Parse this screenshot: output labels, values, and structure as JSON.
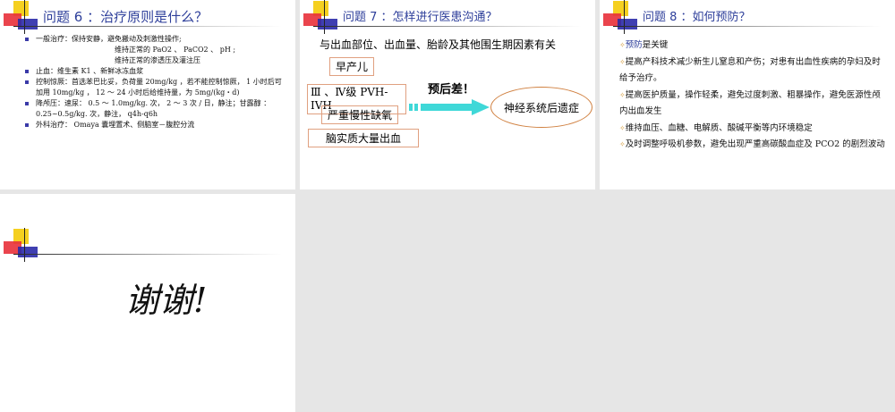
{
  "slide6": {
    "title": "问题 6 ：治疗原则是什么？",
    "items": [
      {
        "text": "一般治疗：保持安静，避免搬动及刺激性操作;",
        "sub": [
          "维持正常的 PaO2 、 PaCO2 、 pH ;",
          "维持正常的渗透压及灌注压"
        ]
      },
      {
        "text": "止血：维生素 K1 、新鲜冰冻血浆"
      },
      {
        "text": "控制惊厥：首选苯巴比妥，负荷量 20mg/kg ，若不能控制惊厥， 1 小时后可加用 10mg/kg ， 12 ～ 24 小时后给维持量，为 5mg/(kg・d)"
      },
      {
        "text": "降颅压：速尿： 0.5 ～ 1.0mg/kg. 次， 2 ～ 3 次 / 日，静注；甘露醇 ： 0.25~0.5g/kg. 次，静注， q4h-q6h"
      },
      {
        "text": "外科治疗： Omaya 囊埋置术、侧脑室－腹腔分流"
      }
    ]
  },
  "slide7": {
    "title": "问题 7 ：怎样进行医患沟通？",
    "intro": "与出血部位、出血量、胎龄及其他围生期因素有关",
    "factors": [
      "早产儿",
      "Ⅲ 、Ⅳ级 PVH-IVH",
      "严重慢性缺氧",
      "脑实质大量出血"
    ],
    "prognosis": "预后差！",
    "outcome": "神经系统后遗症"
  },
  "slide8": {
    "title": "问题 8 ：如何预防？",
    "bullet": "✧",
    "items": [
      {
        "highlight": "预防",
        "text": "是关键"
      },
      {
        "text": "提高产科技术减少新生儿窒息和产伤；对患有出血性疾病的孕妇及时给予治疗。"
      },
      {
        "text": "提高医护质量，操作轻柔，避免过度刺激、粗暴操作，避免医源性颅内出血发生"
      },
      {
        "text": "维持血压、血糖、电解质、酸碱平衡等内环境稳定"
      },
      {
        "text": "及时调整呼吸机参数，避免出现严重高碳酸血症及 PCO2 的剧烈波动"
      }
    ]
  },
  "slide9": {
    "text": "谢谢!"
  }
}
